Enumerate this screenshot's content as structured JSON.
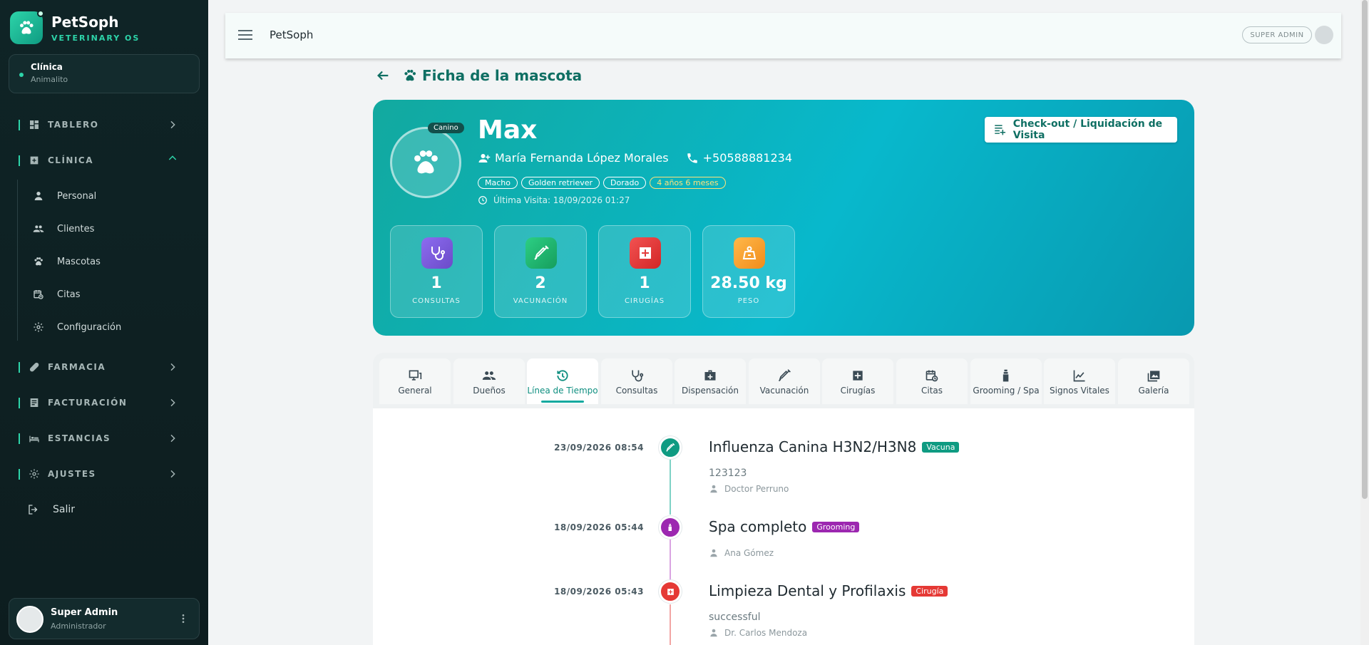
{
  "brand": {
    "name": "PetSoph",
    "subtitle": "VETERINARY OS"
  },
  "clinic": {
    "label": "Clínica",
    "name": "Animalito"
  },
  "sidebar": {
    "sections": [
      {
        "label": "TABLERO",
        "icon": "dashboard-icon"
      },
      {
        "label": "CLÍNICA",
        "icon": "medical-plus-icon"
      },
      {
        "label": "FARMACIA",
        "icon": "pill-icon"
      },
      {
        "label": "FACTURACIÓN",
        "icon": "invoice-icon"
      },
      {
        "label": "ESTANCIAS",
        "icon": "bed-icon"
      },
      {
        "label": "AJUSTES",
        "icon": "gear-icon"
      }
    ],
    "clinic_items": [
      {
        "label": "Personal",
        "icon": "staff-icon"
      },
      {
        "label": "Clientes",
        "icon": "users-icon"
      },
      {
        "label": "Mascotas",
        "icon": "paw-icon"
      },
      {
        "label": "Citas",
        "icon": "calendar-clock-icon"
      },
      {
        "label": "Configuración",
        "icon": "gear-icon"
      }
    ],
    "logout": "Salir"
  },
  "user": {
    "name": "Super Admin",
    "role": "Administrador"
  },
  "topbar": {
    "title": "PetSoph",
    "role_badge": "SUPER ADMIN"
  },
  "page": {
    "title": "Ficha de la mascota"
  },
  "pet": {
    "species": "Canino",
    "name": "Max",
    "owner": "María Fernanda López Morales",
    "phone": "+50588881234",
    "tags": [
      "Macho",
      "Golden retriever",
      "Dorado",
      "4 años 6 meses"
    ],
    "last_visit": "Última Visita: 18/09/2026 01:27"
  },
  "checkout": {
    "label": "Check-out / Liquidación de Visita"
  },
  "stats": [
    {
      "value": "1",
      "label": "CONSULTAS",
      "color": "#7b5cd6"
    },
    {
      "value": "2",
      "label": "VACUNACIÓN",
      "color": "#22b573"
    },
    {
      "value": "1",
      "label": "CIRUGÍAS",
      "color": "#e93b3b"
    },
    {
      "value": "28.50 kg",
      "label": "PESO",
      "color": "#f5a623"
    }
  ],
  "tabs": [
    {
      "label": "General",
      "icon": "monitor-icon"
    },
    {
      "label": "Dueños",
      "icon": "people-icon"
    },
    {
      "label": "Línea de Tiempo",
      "icon": "history-icon"
    },
    {
      "label": "Consultas",
      "icon": "stethoscope-icon"
    },
    {
      "label": "Dispensación",
      "icon": "medkit-icon"
    },
    {
      "label": "Vacunación",
      "icon": "syringe-icon"
    },
    {
      "label": "Cirugías",
      "icon": "hospital-plus-icon"
    },
    {
      "label": "Citas",
      "icon": "calendar-clock-icon"
    },
    {
      "label": "Grooming / Spa",
      "icon": "spray-bottle-icon"
    },
    {
      "label": "Signos Vitales",
      "icon": "chart-line-icon"
    },
    {
      "label": "Galería",
      "icon": "gallery-icon"
    }
  ],
  "timeline": [
    {
      "date": "23/09/2026 08:54",
      "title": "Influenza Canina H3N2/H3N8",
      "badge": "Vacuna",
      "color": "#0f9b82",
      "desc": "123123",
      "doctor": "Doctor Perruno"
    },
    {
      "date": "18/09/2026 05:44",
      "title": "Spa completo",
      "badge": "Grooming",
      "color": "#9c27b0",
      "desc": "",
      "doctor": "Ana Gómez"
    },
    {
      "date": "18/09/2026 05:43",
      "title": "Limpieza Dental y Profilaxis",
      "badge": "Cirugía",
      "color": "#e53935",
      "desc": "successful",
      "doctor": "Dr. Carlos Mendoza"
    }
  ]
}
